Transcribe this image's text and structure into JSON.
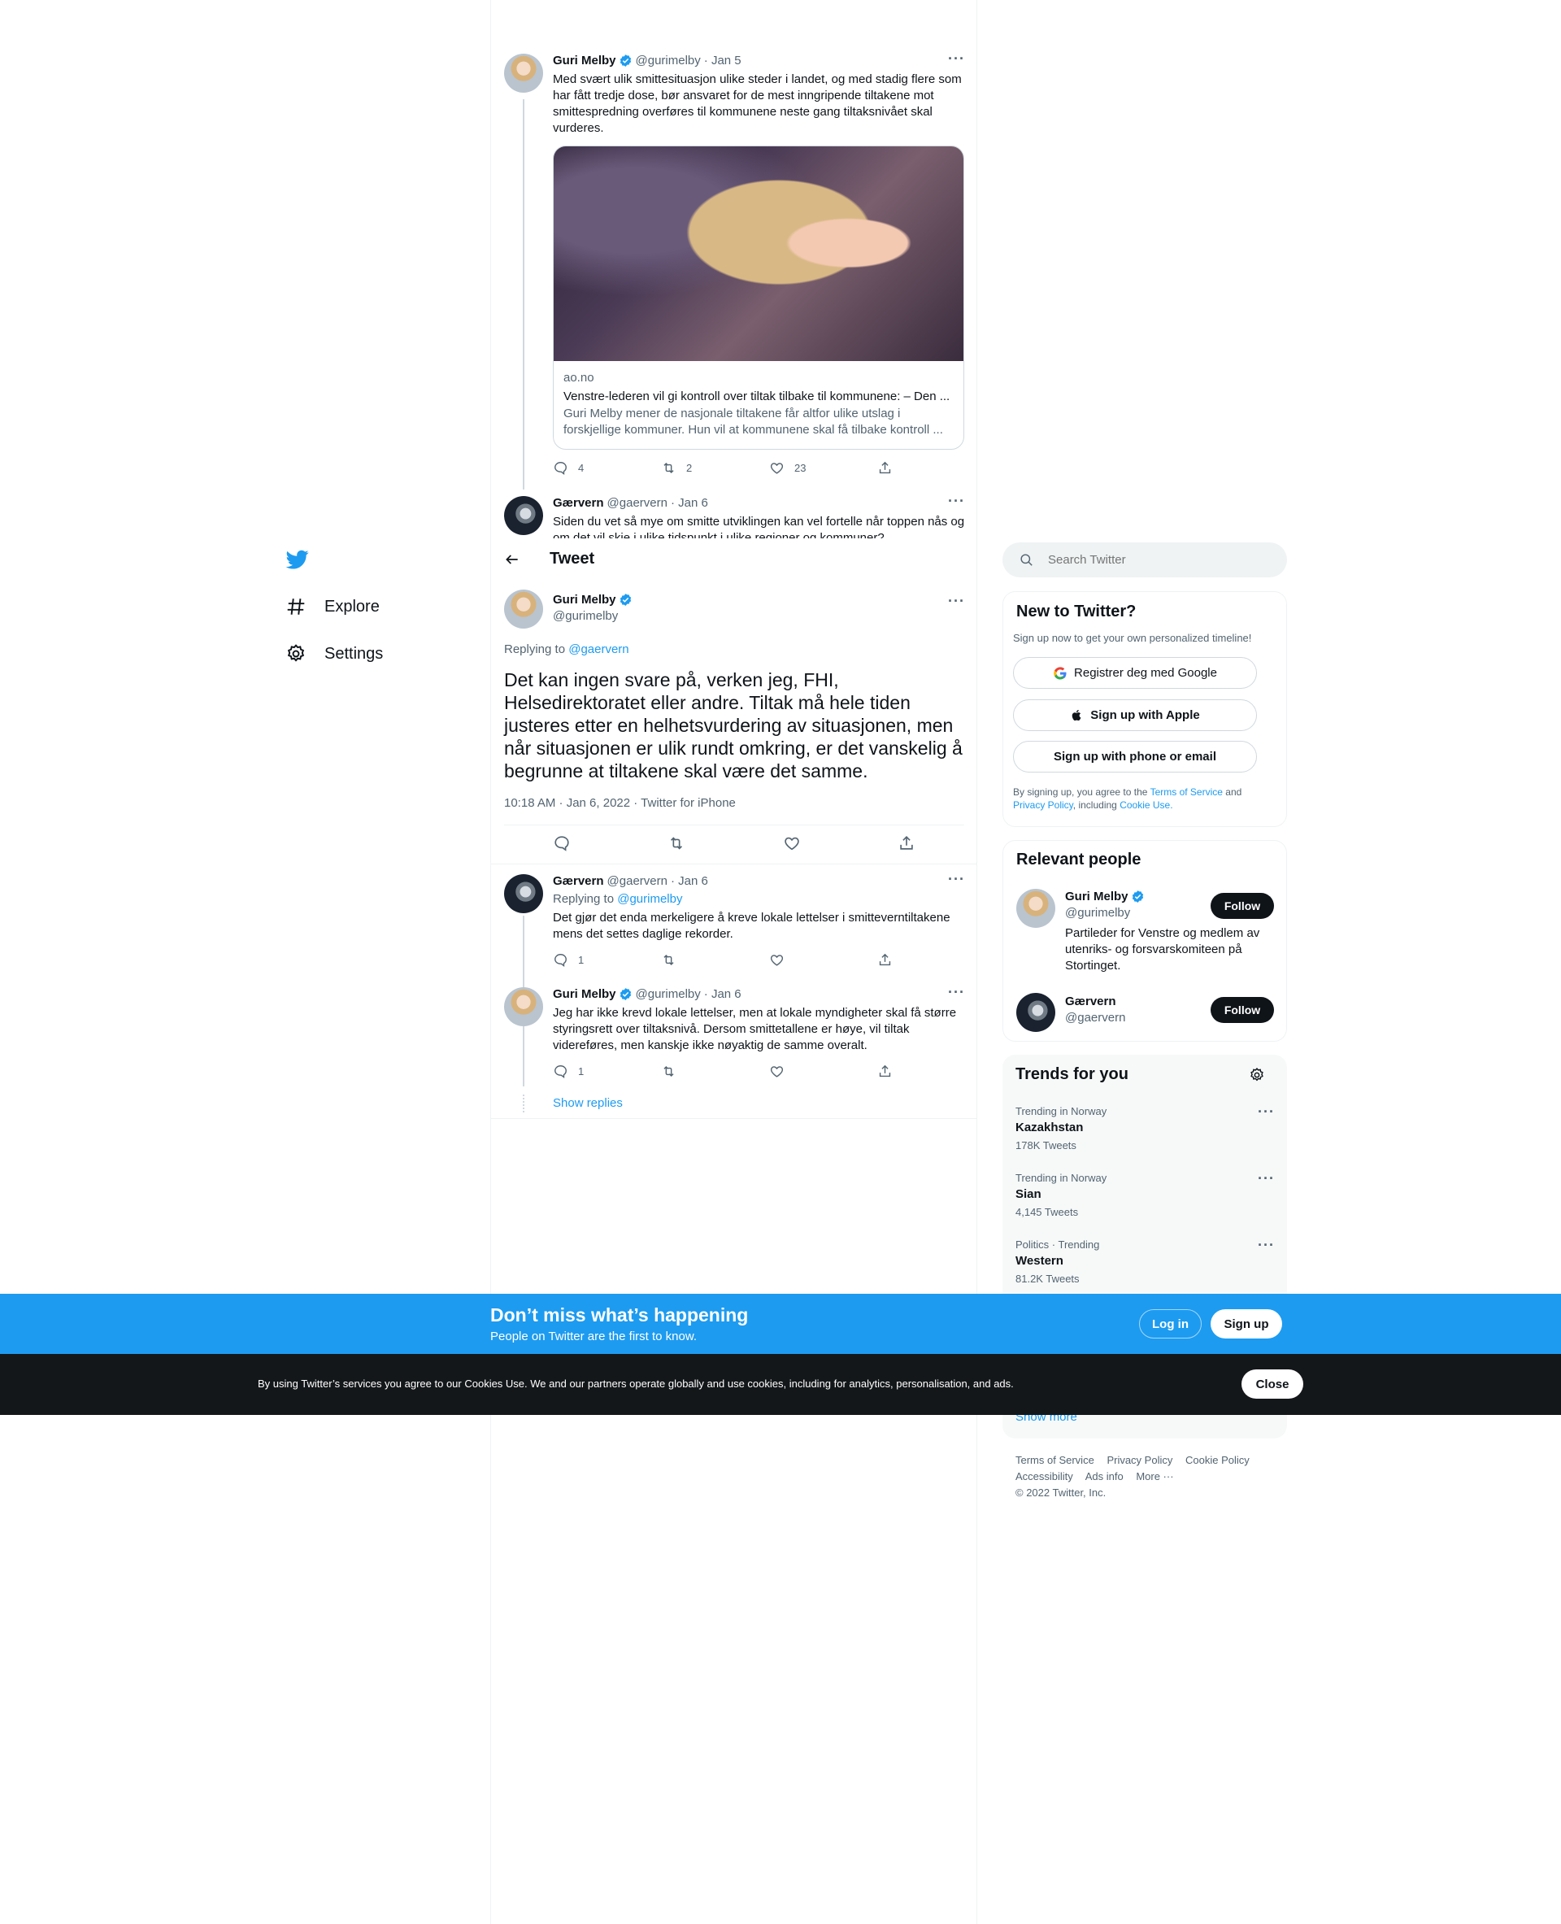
{
  "nav": {
    "items": [
      {
        "label": "Explore",
        "icon": "hashtag-icon"
      },
      {
        "label": "Settings",
        "icon": "gear-icon"
      }
    ]
  },
  "header": {
    "title": "Tweet"
  },
  "parent_tweets": [
    {
      "name": "Guri Melby",
      "handle": "@gurimelby",
      "date": "· Jan 5",
      "text": "Med svært ulik smittesituasjon ulike steder i landet, og med stadig flere som har fått tredje dose, bør ansvaret for de mest inngripende tiltakene mot smittespredning overføres til kommunene neste gang tiltaksnivået skal vurderes.",
      "card": {
        "domain": "ao.no",
        "title": "Venstre-lederen vil gi kontroll over tiltak tilbake til kommunene: – Den ...",
        "description": "Guri Melby mener de nasjonale tiltakene får altfor ulike utslag i forskjellige kommuner. Hun vil at kommunene skal få tilbake kontroll ..."
      },
      "replies": "4",
      "retweets": "2",
      "likes": "23"
    },
    {
      "name": "Gærvern",
      "handle": "@gaervern",
      "date": "· Jan 6",
      "text": "Siden du vet så mye om smitte utviklingen kan vel fortelle når toppen nås og om det vil skje i ulike tidspunkt i ulike regioner og kommuner?"
    }
  ],
  "main_tweet": {
    "name": "Guri Melby",
    "handle": "@gurimelby",
    "replying_prefix": "Replying to",
    "replying_to": "@gaervern",
    "text": "Det kan ingen svare på, verken jeg, FHI, Helsedirektoratet eller andre. Tiltak må hele tiden justeres etter en helhetsvurdering av situasjonen, men når situasjonen er ulik rundt omkring, er det vanskelig å begrunne at tiltakene skal være det samme.",
    "timestamp": "10:18 AM · Jan 6, 2022 · Twitter for iPhone"
  },
  "replies": [
    {
      "name": "Gærvern",
      "handle": "@gaervern",
      "date": "· Jan 6",
      "replying_prefix": "Replying to",
      "replying_to": "@gurimelby",
      "text": "Det gjør det enda merkeligere å kreve lokale lettelser i smitteverntiltakene mens det settes daglige rekorder.",
      "replies": "1"
    },
    {
      "name": "Guri Melby",
      "handle": "@gurimelby",
      "date": "· Jan 6",
      "text": "Jeg har ikke krevd lokale lettelser, men at lokale myndigheter skal få større styringsrett over tiltaksnivå. Dersom smittetallene er høye, vil tiltak videreføres, men kanskje ikke nøyaktig de samme overalt.",
      "replies": "1"
    }
  ],
  "show_replies": "Show replies",
  "search": {
    "placeholder": "Search Twitter"
  },
  "new_to_twitter": {
    "title": "New to Twitter?",
    "subtitle": "Sign up now to get your own personalized timeline!",
    "google": "Registrer deg med Google",
    "apple": "Sign up with Apple",
    "phone": "Sign up with phone or email",
    "legal_1": "By signing up, you agree to the",
    "terms": "Terms of Service",
    "legal_and": "and",
    "privacy": "Privacy Policy",
    "legal_including": ", including",
    "cookie": "Cookie Use."
  },
  "relevant_people": {
    "title": "Relevant people",
    "people": [
      {
        "name": "Guri Melby",
        "handle": "@gurimelby",
        "bio": "Partileder for Venstre og medlem av utenriks- og forsvarskomiteen på Stortinget.",
        "follow": "Follow"
      },
      {
        "name": "Gærvern",
        "handle": "@gaervern",
        "follow": "Follow"
      }
    ]
  },
  "trends": {
    "title": "Trends for you",
    "items": [
      {
        "meta": "Trending in Norway",
        "name": "Kazakhstan",
        "count": "178K Tweets"
      },
      {
        "meta": "Trending in Norway",
        "name": "Sian",
        "count": "4,145 Tweets"
      },
      {
        "meta": "Politics · Trending",
        "name": "Western",
        "count": "81.2K Tweets"
      }
    ],
    "show_more": "Show more"
  },
  "footer": {
    "links": [
      "Terms of Service",
      "Privacy Policy",
      "Cookie Policy",
      "Accessibility",
      "Ads info",
      "More ···"
    ],
    "copyright": "© 2022 Twitter, Inc."
  },
  "bottom_bar": {
    "title": "Don’t miss what’s happening",
    "subtitle": "People on Twitter are the first to know.",
    "login": "Log in",
    "signup": "Sign up"
  },
  "cookie_bar": {
    "text": "By using Twitter’s services you agree to our Cookies Use. We and our partners operate globally and use cookies, including for analytics, personalisation, and ads.",
    "close": "Close"
  },
  "colors": {
    "accent": "#1d9bf0",
    "dark": "#0f1419",
    "muted": "#536471"
  }
}
